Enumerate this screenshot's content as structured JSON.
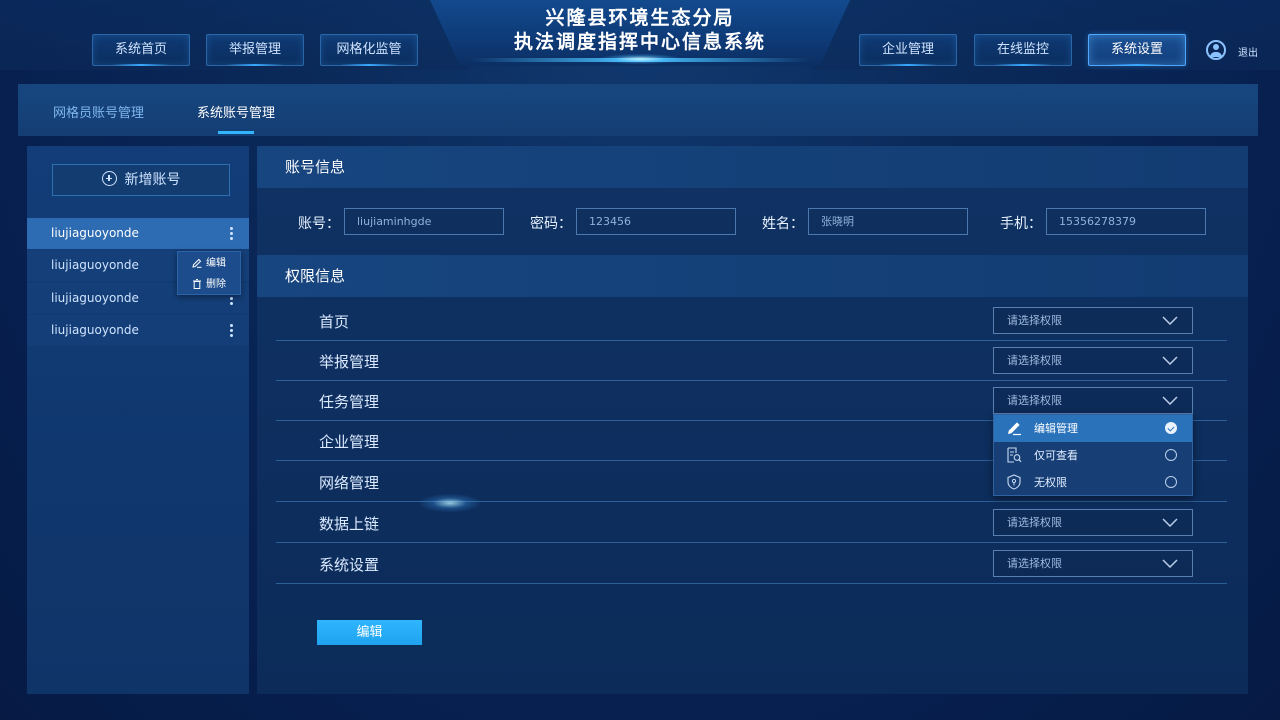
{
  "header": {
    "title_line1": "兴隆县环境生态分局",
    "title_line2": "执法调度指挥中心信息系统",
    "nav_left": [
      "系统首页",
      "举报管理",
      "网格化监管"
    ],
    "nav_right": [
      "企业管理",
      "在线监控",
      "系统设置"
    ],
    "active_nav": "系统设置",
    "logout_label": "退出"
  },
  "subtabs": {
    "items": [
      "网格员账号管理",
      "系统账号管理"
    ],
    "active": "系统账号管理"
  },
  "sidebar": {
    "add_button_label": "新增账号",
    "accounts": [
      "liujiaguoyonde",
      "liujiaguoyonde",
      "liujiaguoyonde",
      "liujiaguoyonde"
    ],
    "context_menu": {
      "edit_label": "编辑",
      "delete_label": "删除"
    }
  },
  "account_info": {
    "section_title": "账号信息",
    "fields": {
      "account": {
        "label": "账号：",
        "value": "liujiaminhgde"
      },
      "password": {
        "label": "密码：",
        "value": "123456"
      },
      "name": {
        "label": "姓名：",
        "value": "张晓明"
      },
      "phone": {
        "label": "手机：",
        "value": "15356278379"
      }
    }
  },
  "permissions": {
    "section_title": "权限信息",
    "placeholder": "请选择权限",
    "rows": [
      "首页",
      "举报管理",
      "任务管理",
      "企业管理",
      "网络管理",
      "数据上链",
      "系统设置"
    ],
    "dropdown": {
      "options": [
        "编辑管理",
        "仅可查看",
        "无权限"
      ],
      "selected": "编辑管理"
    }
  },
  "actions": {
    "edit_label": "编辑"
  },
  "colors": {
    "accent": "#33b4ff",
    "selected_item": "#2a73bb",
    "panel": "#0f3264",
    "button": "#1fa3f0"
  }
}
